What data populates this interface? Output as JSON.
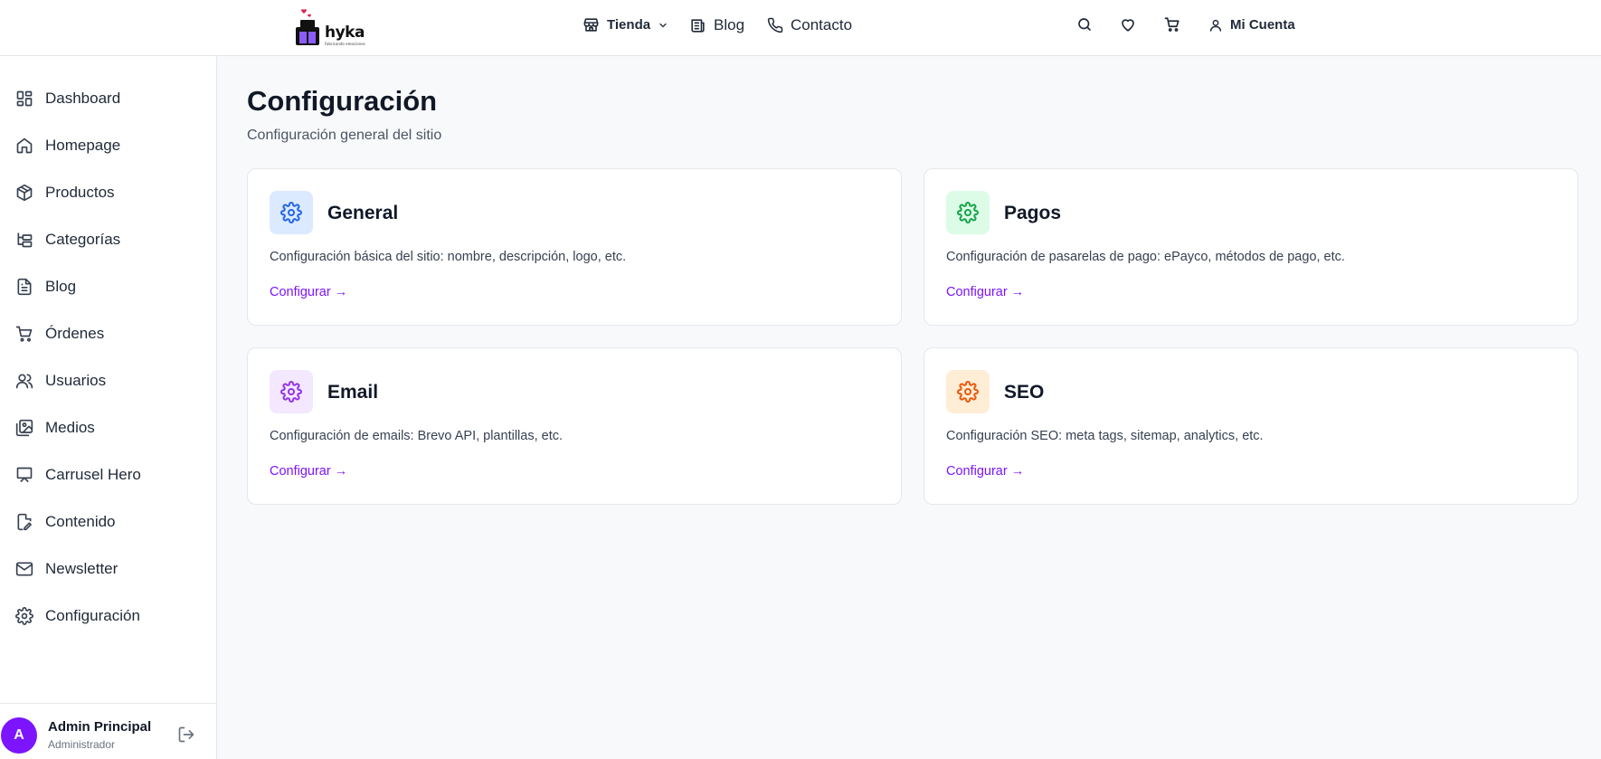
{
  "header": {
    "logo_text": "hyka",
    "logo_tagline": "Fabricando emociones",
    "nav": {
      "tienda": "Tienda",
      "blog": "Blog",
      "contacto": "Contacto",
      "account": "Mi Cuenta"
    },
    "icons": [
      "search-icon",
      "heart-icon",
      "cart-icon",
      "user-icon"
    ]
  },
  "sidebar": {
    "items": [
      {
        "label": "Dashboard",
        "icon": "dashboard-icon"
      },
      {
        "label": "Homepage",
        "icon": "home-icon"
      },
      {
        "label": "Productos",
        "icon": "box-icon"
      },
      {
        "label": "Categorías",
        "icon": "tree-icon"
      },
      {
        "label": "Blog",
        "icon": "document-icon"
      },
      {
        "label": "Órdenes",
        "icon": "cart-icon"
      },
      {
        "label": "Usuarios",
        "icon": "users-icon"
      },
      {
        "label": "Medios",
        "icon": "images-icon"
      },
      {
        "label": "Carrusel Hero",
        "icon": "presentation-icon"
      },
      {
        "label": "Contenido",
        "icon": "file-edit-icon"
      },
      {
        "label": "Newsletter",
        "icon": "mail-icon"
      },
      {
        "label": "Configuración",
        "icon": "gear-icon"
      }
    ],
    "user": {
      "initial": "A",
      "name": "Admin Principal",
      "role": "Administrador"
    }
  },
  "main": {
    "title": "Configuración",
    "subtitle": "Configuración general del sitio",
    "cards": [
      {
        "title": "General",
        "description": "Configuración básica del sitio: nombre, descripción, logo, etc.",
        "link": "Configurar →",
        "icon_bg": "#dbeafe",
        "icon_color": "#2563eb"
      },
      {
        "title": "Pagos",
        "description": "Configuración de pasarelas de pago: ePayco, métodos de pago, etc.",
        "link": "Configurar →",
        "icon_bg": "#dcfce7",
        "icon_color": "#16a34a"
      },
      {
        "title": "Email",
        "description": "Configuración de emails: Brevo API, plantillas, etc.",
        "link": "Configurar →",
        "icon_bg": "#f3e8ff",
        "icon_color": "#9333ea"
      },
      {
        "title": "SEO",
        "description": "Configuración SEO: meta tags, sitemap, analytics, etc.",
        "link": "Configurar →",
        "icon_bg": "#ffedd5",
        "icon_color": "#ea580c"
      }
    ]
  },
  "colors": {
    "accent": "#7c14ff",
    "background": "#f8f9fb"
  }
}
